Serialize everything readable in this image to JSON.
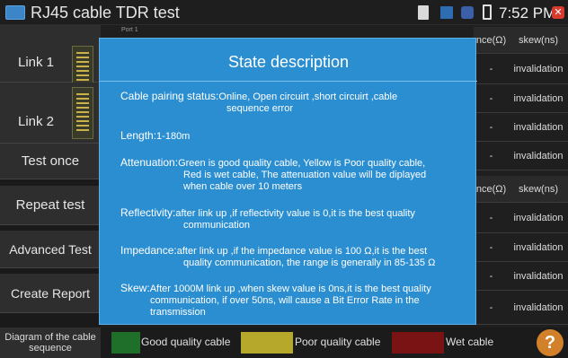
{
  "window": {
    "title": "RJ45 cable TDR test"
  },
  "status": {
    "time": "7:52 PM"
  },
  "side": {
    "link1": "Link 1",
    "link2": "Link 2",
    "test_once": "Test once",
    "repeat_test": "Repeat test",
    "advanced_test": "Advanced Test",
    "create_report": "Create Report"
  },
  "table": {
    "port_label": "Port 1",
    "impedance_header": "nce(Ω)",
    "skew_header": "skew(ns)",
    "dash": "-",
    "rows_top": [
      "invalidation",
      "invalidation",
      "invalidation",
      "invalidation"
    ],
    "rows_bottom": [
      "invalidation",
      "invalidation",
      "invalidation",
      "invalidation"
    ]
  },
  "legend": {
    "diagram_button": "Diagram of the cable sequence",
    "good": "Good quality cable",
    "poor": "Poor quality cable",
    "wet": "Wet cable",
    "help": "?"
  },
  "colors": {
    "good": "#1f6e2a",
    "poor": "#b5a82a",
    "wet": "#7a1414",
    "modal_bg": "#2b8ed1"
  },
  "modal": {
    "title": "State description",
    "pairing_key": "Cable pairing status:",
    "pairing_val": "Online, Open circuirt ,short circuirt ,cable",
    "pairing_val2": "sequence error",
    "length_key": "Length:",
    "length_val": "1-180m",
    "atten_key": "Attenuation:",
    "atten_val": "Green is good quality cable, Yellow is Poor quality cable,",
    "atten_val2": "Red is wet cable, The attenuation value will be diplayed",
    "atten_val3": "when cable over 10 meters",
    "refl_key": "Reflectivity:",
    "refl_val": "after link up ,if reflectivity value is 0,it is the best quality",
    "refl_val2": "communication",
    "imp_key": "Impedance:",
    "imp_val": "after link up ,if the impedance value is 100 Ω,it is the best",
    "imp_val2": "quality communication, the range is generally in 85-135 Ω",
    "skew_key": "Skew:",
    "skew_val": "After 1000M link up ,when skew value is 0ns,it is the best quality",
    "skew_val2": "communication, if over 50ns, will cause a Bit Error Rate in the",
    "skew_val3": "transmission"
  }
}
